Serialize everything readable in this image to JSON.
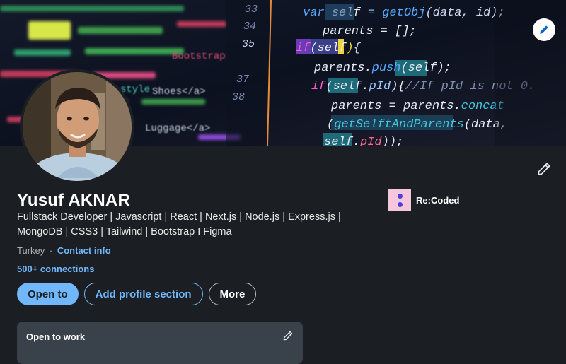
{
  "profile": {
    "name": "Yusuf AKNAR",
    "headline": "Fullstack Developer | Javascript | React | Next.js | Node.js | Express.js | MongoDB | CSS3 | Tailwind | Bootstrap I Figma",
    "location": "Turkey",
    "separator": "·",
    "contact_label": "Contact info",
    "connections": "500+ connections"
  },
  "organization": {
    "name": "Re:Coded"
  },
  "actions": {
    "open_to": "Open to",
    "add_section": "Add profile section",
    "more": "More"
  },
  "open_to_work": {
    "title": "Open to work"
  },
  "banner_code": {
    "line_numbers": [
      "33",
      "34",
      "35",
      "37",
      "38"
    ],
    "lines": [
      "var self = getObj(data, id);",
      "parents = [];",
      "if(self){",
      "parents.push(self);",
      "if(self.pId){//If pId is not 0.",
      "parents = parents.concat",
      "(getSelftAndParents(data,",
      "self.pId));"
    ],
    "left_fragments": [
      "Shoes</a>",
      "Luggage</a>",
      "Bootstrap",
      "style"
    ]
  },
  "icons": {
    "banner_edit": "pencil-icon",
    "profile_edit": "pencil-icon",
    "open_to_work_edit": "pencil-icon",
    "org_logo": "recoded-logo"
  },
  "colors": {
    "accent": "#71b7fb",
    "background": "#1b1f23",
    "panel": "#39424a",
    "org_logo_bg": "#f6c6dc",
    "org_logo_dots": "#4b3fd6"
  }
}
